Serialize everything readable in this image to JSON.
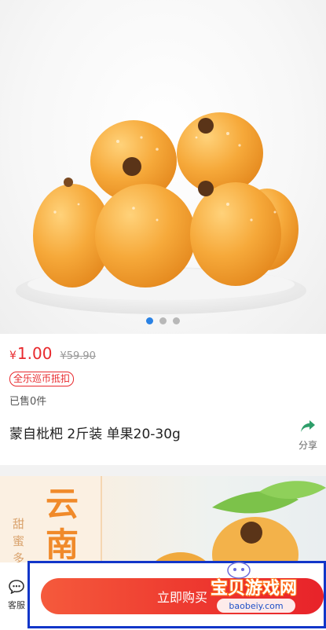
{
  "gallery": {
    "slide_count": 3,
    "active_index": 0
  },
  "product": {
    "price_symbol": "¥",
    "price": "1.00",
    "original_price": "¥59.90",
    "badge": "全乐巡币抵扣",
    "sold": "已售0件",
    "title": "蒙自枇杷 2斤装 单果20-30g",
    "share_label": "分享"
  },
  "detail_banner": {
    "side_text": "甜蜜多",
    "big_text": "云南"
  },
  "bottom_bar": {
    "service_label": "客服",
    "buy_label": "立即购买"
  },
  "watermark": {
    "brand": "宝贝游戏网",
    "domain": "baobeiy.com"
  },
  "colors": {
    "accent": "#e8292d",
    "dot_active": "#2a82e4",
    "share_icon": "#2e9e6a",
    "frame": "#1136c9"
  }
}
